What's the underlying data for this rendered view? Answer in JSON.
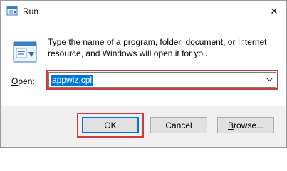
{
  "window": {
    "title": "Run",
    "title_icon": "run-icon",
    "close_glyph": "✕"
  },
  "dialog": {
    "description_line1": "Type the name of a program, folder, document, or Internet",
    "description_line2": "resource, and Windows will open it for you.",
    "open_label_mnemonic": "O",
    "open_label_rest": "pen:",
    "open_value": "appwiz.cpl",
    "dropdown_icon": "chevron-down-icon"
  },
  "buttons": {
    "ok_label": "OK",
    "cancel_label": "Cancel",
    "browse_mnemonic": "B",
    "browse_rest": "rowse..."
  },
  "colors": {
    "highlight_box": "#d0393e",
    "selection": "#0078d7",
    "dialog_bg": "#f0f0f0"
  }
}
